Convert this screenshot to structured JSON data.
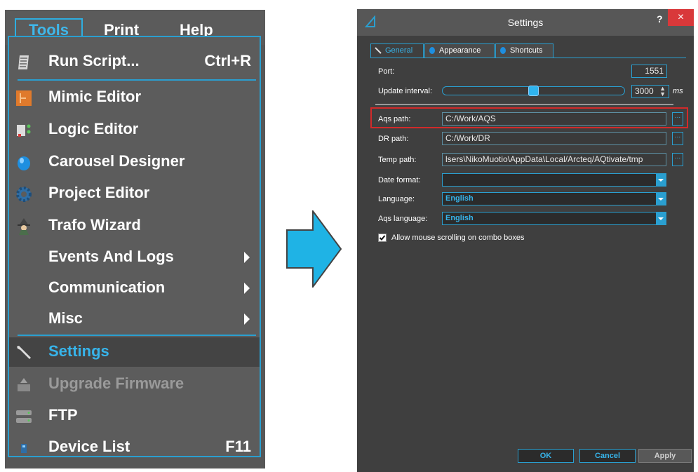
{
  "menubar": {
    "tools": "Tools",
    "print": "Print",
    "help": "Help"
  },
  "menu": {
    "items": [
      {
        "label": "Run Script...",
        "shortcut": "Ctrl+R",
        "icon": "script-icon"
      },
      {
        "label": "Mimic Editor",
        "icon": "mimic-editor-icon"
      },
      {
        "label": "Logic Editor",
        "icon": "logic-editor-icon"
      },
      {
        "label": "Carousel Designer",
        "icon": "carousel-designer-icon"
      },
      {
        "label": "Project Editor",
        "icon": "gear-icon"
      },
      {
        "label": "Trafo Wizard",
        "icon": "wizard-icon"
      },
      {
        "label": "Events And Logs",
        "submenu": true
      },
      {
        "label": "Communication",
        "submenu": true
      },
      {
        "label": "Misc",
        "submenu": true
      },
      {
        "label": "Settings",
        "icon": "wrench-icon",
        "selected": true
      },
      {
        "label": "Upgrade Firmware",
        "icon": "upgrade-firmware-icon",
        "disabled": true
      },
      {
        "label": "FTP",
        "icon": "ftp-icon"
      },
      {
        "label": "Device List",
        "shortcut": "F11",
        "icon": "device-list-icon"
      }
    ]
  },
  "dialog": {
    "title": "Settings",
    "help": "?",
    "close": "×",
    "tabs": [
      {
        "label": "General",
        "active": true
      },
      {
        "label": "Appearance"
      },
      {
        "label": "Shortcuts"
      }
    ],
    "port_label": "Port:",
    "port_value": "1551",
    "update_label": "Update interval:",
    "update_value": "3000",
    "update_unit": "ms",
    "update_slider_fraction": 0.5,
    "aqs_path_label": "Aqs path:",
    "aqs_path_value": "C:/Work/AQS",
    "dr_path_label": "DR path:",
    "dr_path_value": "C:/Work/DR",
    "temp_path_label": "Temp path:",
    "temp_path_value": "lsers\\NikoMuotio\\AppData\\Local/Arcteq/AQtivate/tmp",
    "browse": "...",
    "date_format_label": "Date format:",
    "date_format_value": "",
    "language_label": "Language:",
    "language_value": "English",
    "aqs_language_label": "Aqs language:",
    "aqs_language_value": "English",
    "scroll_checkbox_label": "Allow mouse scrolling on combo boxes",
    "scroll_checkbox_checked": true,
    "ok": "OK",
    "cancel": "Cancel",
    "apply": "Apply"
  },
  "colors": {
    "accent": "#2a9fd0",
    "highlight": "#d22a2a",
    "arrow": "#1fb3e5"
  }
}
